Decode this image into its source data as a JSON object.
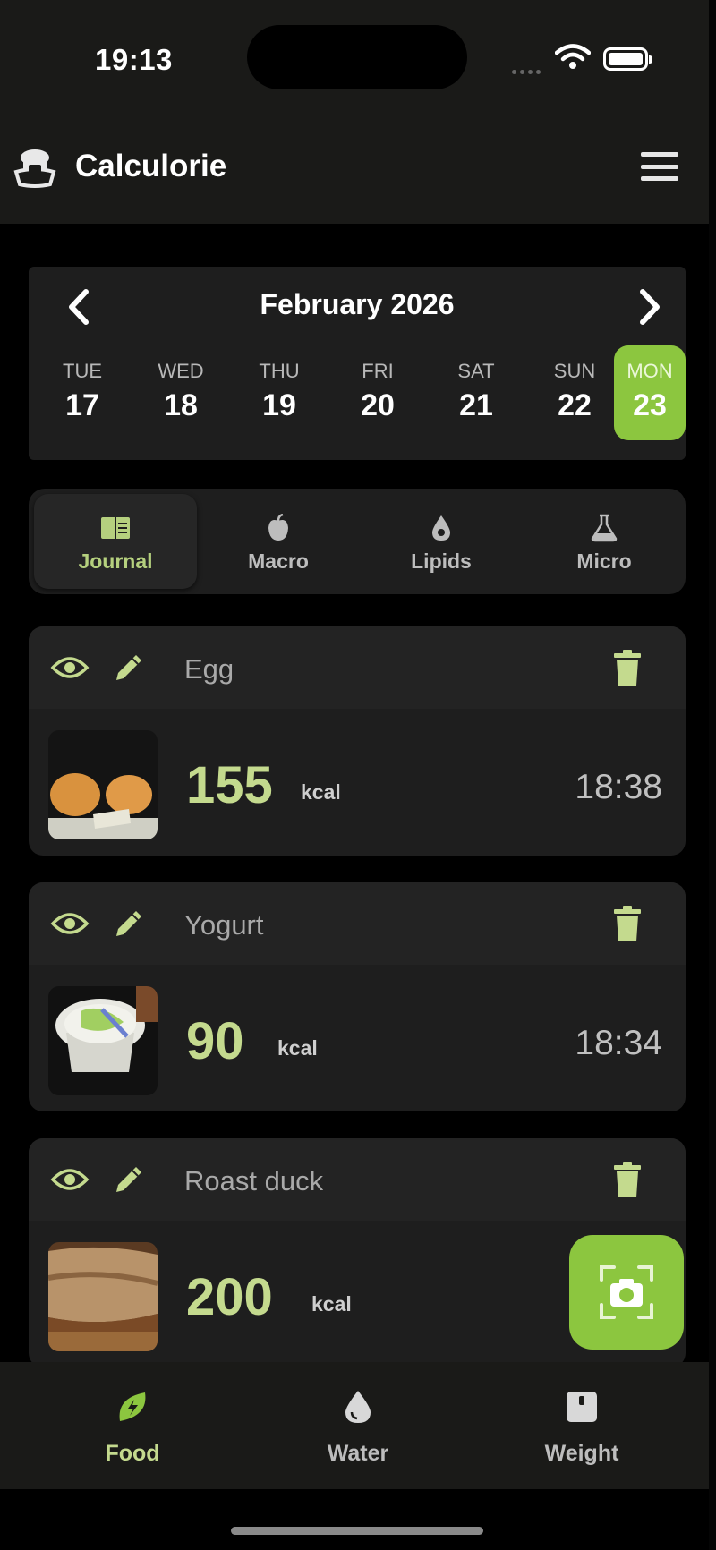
{
  "status_bar": {
    "time": "19:13"
  },
  "header": {
    "app_title": "Calculorie",
    "logo_icon": "chef-logo-icon",
    "menu_icon": "hamburger-menu-icon"
  },
  "calendar": {
    "month": "February 2026",
    "days": [
      {
        "dow": "TUE",
        "num": "17",
        "selected": false
      },
      {
        "dow": "WED",
        "num": "18",
        "selected": false
      },
      {
        "dow": "THU",
        "num": "19",
        "selected": false
      },
      {
        "dow": "FRI",
        "num": "20",
        "selected": false
      },
      {
        "dow": "SAT",
        "num": "21",
        "selected": false
      },
      {
        "dow": "SUN",
        "num": "22",
        "selected": false
      },
      {
        "dow": "MON",
        "num": "23",
        "selected": true
      }
    ]
  },
  "tabs": [
    {
      "label": "Journal",
      "icon": "book-icon",
      "active": true
    },
    {
      "label": "Macro",
      "icon": "apple-icon",
      "active": false
    },
    {
      "label": "Lipids",
      "icon": "oil-drop-icon",
      "active": false
    },
    {
      "label": "Micro",
      "icon": "flask-icon",
      "active": false
    }
  ],
  "entries": [
    {
      "name": "Egg",
      "kcal": "155",
      "unit": "kcal",
      "time": "18:38"
    },
    {
      "name": "Yogurt",
      "kcal": "90",
      "unit": "kcal",
      "time": "18:34"
    },
    {
      "name": "Roast duck",
      "kcal": "200",
      "unit": "kcal",
      "time": ""
    }
  ],
  "bottom_nav": [
    {
      "label": "Food",
      "icon": "leaf-bolt-icon",
      "active": true
    },
    {
      "label": "Water",
      "icon": "water-drop-icon",
      "active": false
    },
    {
      "label": "Weight",
      "icon": "scale-icon",
      "active": false
    }
  ],
  "colors": {
    "accent": "#8cc63f",
    "accent_text": "#c4da8e",
    "card": "#1e1e1e",
    "background": "#000000"
  }
}
